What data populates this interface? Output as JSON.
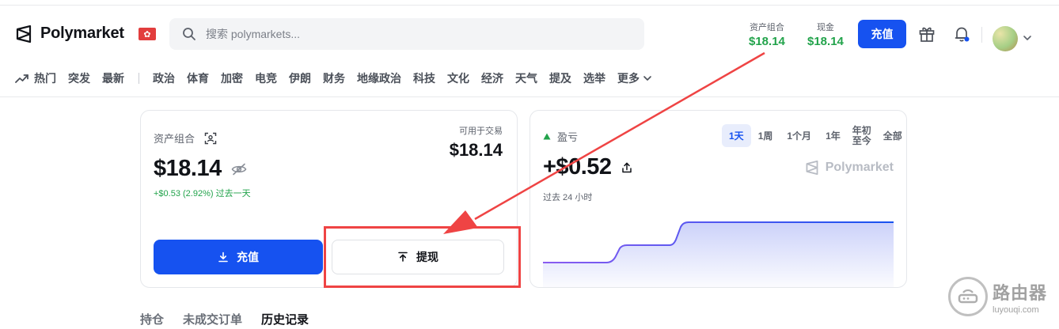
{
  "header": {
    "brand": "Polymarket",
    "flag_symbol": "✿",
    "search_placeholder": "搜索 polymarkets...",
    "portfolio_label": "资产组合",
    "portfolio_value": "$18.14",
    "cash_label": "现金",
    "cash_value": "$18.14",
    "deposit_label": "充值"
  },
  "nav": {
    "items": [
      "热门",
      "突发",
      "最新",
      "政治",
      "体育",
      "加密",
      "电竞",
      "伊朗",
      "财务",
      "地缘政治",
      "科技",
      "文化",
      "经济",
      "天气",
      "提及",
      "选举"
    ],
    "more_label": "更多"
  },
  "portfolio_card": {
    "title": "资产组合",
    "available_label": "可用于交易",
    "available_value": "$18.14",
    "balance": "$18.14",
    "change": "+$0.53 (2.92%) 过去一天",
    "deposit_label": "充值",
    "withdraw_label": "提现"
  },
  "pnl_card": {
    "title": "盈亏",
    "ranges": [
      "1天",
      "1周",
      "1个月",
      "1年",
      "年初至今",
      "全部"
    ],
    "active_range": "1天",
    "value": "+$0.52",
    "period": "过去 24 小时",
    "watermark": "Polymarket"
  },
  "tabs": {
    "items": [
      "持仓",
      "未成交订单",
      "历史记录"
    ],
    "active": "历史记录"
  },
  "watermark": {
    "cn": "路由器",
    "en": "luyouqi.com"
  },
  "colors": {
    "accent": "#1652f0",
    "positive": "#22a34b",
    "annotation": "#ef4444"
  }
}
